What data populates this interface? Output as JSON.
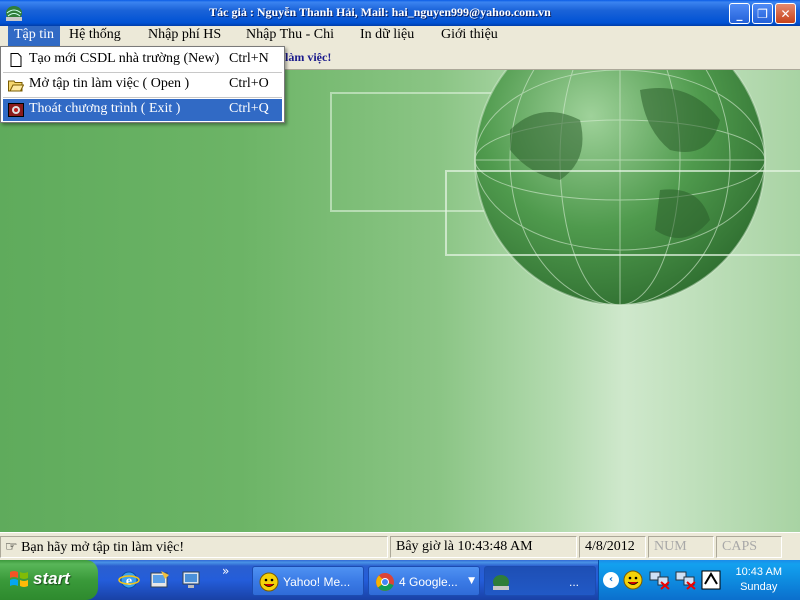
{
  "window": {
    "title": "Tác giả : Nguyễn Thanh Hải,  Mail: hai_nguyen999@yahoo.com.vn",
    "minimize": "_",
    "maximize": "❐",
    "close": "✕"
  },
  "menubar": {
    "items": [
      {
        "label": "Tập tin"
      },
      {
        "label": "Hệ thống"
      },
      {
        "label": "Nhập phí HS"
      },
      {
        "label": "Nhập Thu - Chi"
      },
      {
        "label": "In dữ liệu"
      },
      {
        "label": "Giới thiệu"
      }
    ]
  },
  "toolstrip": {
    "message_tail": "làm việc!"
  },
  "file_menu": {
    "items": [
      {
        "label": "Tạo mới CSDL nhà trường (New)",
        "shortcut": "Ctrl+N",
        "icon": "new-document-icon"
      },
      {
        "label": "Mở tập tin làm việc ( Open )",
        "shortcut": "Ctrl+O",
        "icon": "open-folder-icon"
      },
      {
        "label": "Thoát chương trình ( Exit )",
        "shortcut": "Ctrl+Q",
        "icon": "exit-icon"
      }
    ]
  },
  "statusbar": {
    "message": "Bạn hãy mở tập tin làm việc!",
    "clock": "Bây giờ là 10:43:48 AM",
    "date": "4/8/2012",
    "num": "NUM",
    "caps": "CAPS"
  },
  "taskbar": {
    "start_label": "start",
    "chevron": "»",
    "tasks": [
      {
        "label": "Yahoo! Me...",
        "icon": "yahoo-messenger-icon"
      },
      {
        "label": "4 Google...",
        "icon": "chrome-icon"
      },
      {
        "label": "...",
        "icon": "app-icon"
      }
    ],
    "time": "10:43 AM",
    "day": "Sunday"
  },
  "colors": {
    "menu_highlight": "#316ac5",
    "main_green": "#6cb466"
  }
}
